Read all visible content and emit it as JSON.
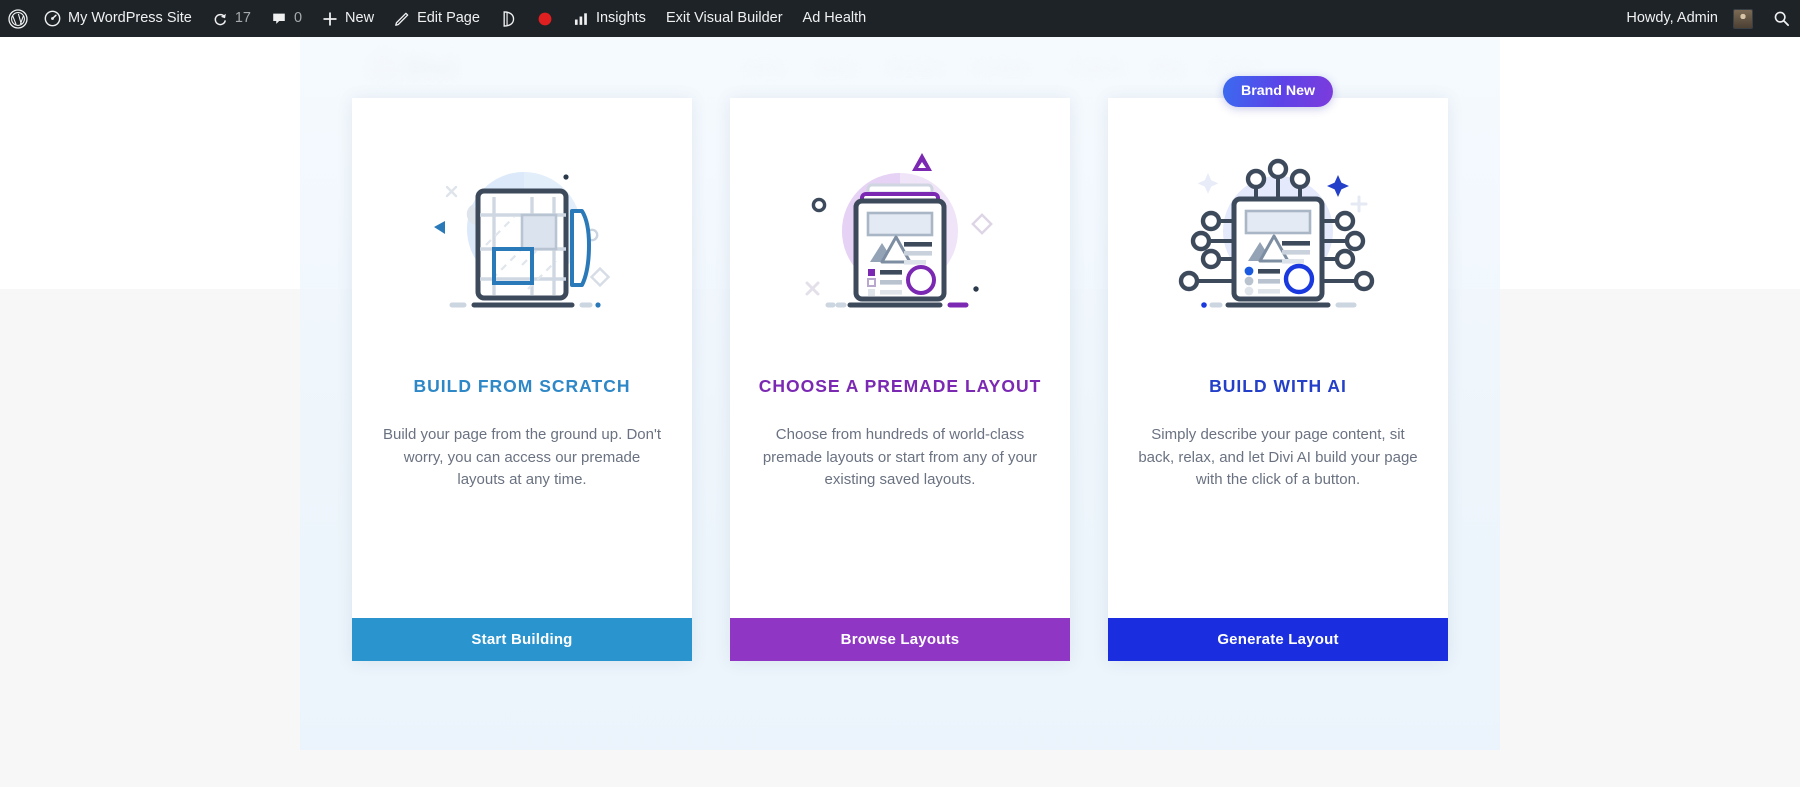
{
  "adminbar": {
    "left_items": [
      {
        "icon": "wordpress-logo-icon",
        "label": ""
      },
      {
        "icon": "dashboard-icon",
        "label": "My WordPress Site"
      },
      {
        "icon": "updates-icon",
        "label": "17"
      },
      {
        "icon": "comment-bubble-icon",
        "label": "0"
      },
      {
        "icon": "plus-icon",
        "label": "New"
      },
      {
        "icon": "pencil-icon",
        "label": "Edit Page"
      },
      {
        "icon": "divi-icon",
        "label": ""
      },
      {
        "icon": "record-dot-icon",
        "label": ""
      },
      {
        "icon": "bar-chart-icon",
        "label": "Insights"
      },
      {
        "icon": "",
        "label": "Exit Visual Builder"
      },
      {
        "icon": "",
        "label": "Ad Health"
      }
    ],
    "howdy": "Howdy, Admin",
    "search_icon": "search-icon"
  },
  "backdrop": {
    "logo_text": "Divi",
    "logo_mark": "D",
    "nav": [
      "Home",
      "About",
      "Services",
      "Portfolio"
    ],
    "nav2": [
      "Projects",
      "Blog",
      "Contact"
    ]
  },
  "cards": [
    {
      "id": "build-from-scratch",
      "title": "BUILD FROM SCRATCH",
      "description": "Build your page from the ground up. Don't worry, you can access our premade layouts at any time.",
      "cta": "Start Building",
      "cta_color": "#2a94cf",
      "title_color": "#2e87c6",
      "illustration": "blueprint-grid-pencil-illustration",
      "badge": null
    },
    {
      "id": "choose-premade-layout",
      "title": "CHOOSE A PREMADE LAYOUT",
      "description": "Choose from hundreds of world-class premade layouts or start from any of your existing saved layouts.",
      "cta": "Browse Layouts",
      "cta_color": "#8f37c4",
      "title_color": "#7b28b3",
      "illustration": "layout-stack-illustration",
      "badge": null
    },
    {
      "id": "build-with-ai",
      "title": "BUILD WITH AI",
      "description": "Simply describe your page content, sit back, relax, and let Divi AI build your page with the click of a button.",
      "cta": "Generate Layout",
      "cta_color": "#1a2ee0",
      "title_color": "#2440c9",
      "illustration": "ai-neural-layout-illustration",
      "badge": "Brand New"
    }
  ]
}
